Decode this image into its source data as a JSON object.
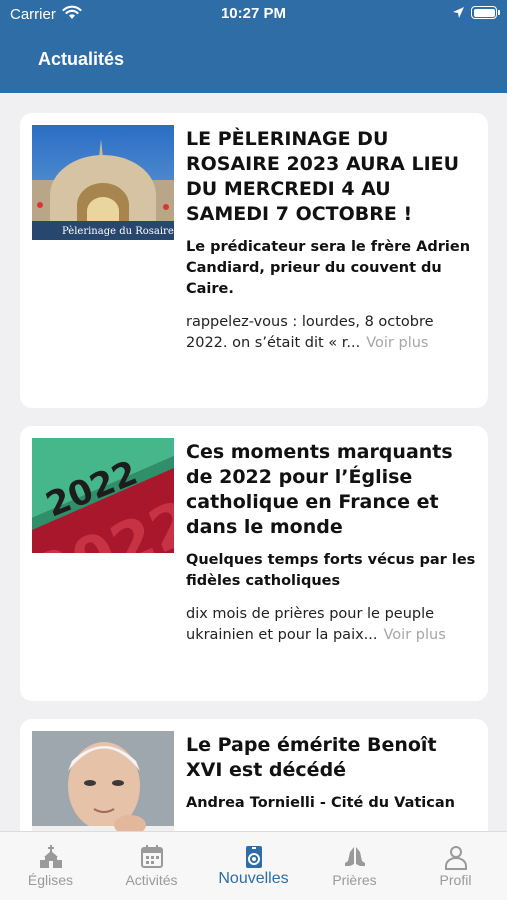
{
  "status": {
    "carrier": "Carrier",
    "time": "10:27 PM"
  },
  "header": {
    "title": "Actualités"
  },
  "articles": [
    {
      "title": "LE PÈLERINAGE DU ROSAIRE 2023 AURA LIEU DU MERCREDI 4 AU SAMEDI 7 OCTOBRE !",
      "subtitle": "Le prédicateur sera le frère Adrien Candiard, prieur du couvent du Caire.",
      "excerpt": "rappelez-vous : lourdes, 8 octobre 2022.  on s’était dit « r...",
      "more": "Voir plus",
      "image_caption": "Pèlerinage du Rosaire"
    },
    {
      "title": "Ces moments marquants de 2022 pour l’Église catholique en France et dans le monde",
      "subtitle": "Quelques temps forts vécus par les fidèles catholiques",
      "excerpt": "dix mois de prières pour le peuple ukrainien et pour la paix...",
      "more": "Voir plus",
      "image_text": "2022"
    },
    {
      "title": "Le Pape émérite Benoît XVI est décédé",
      "subtitle": "Andrea Tornielli - Cité du Vatican"
    }
  ],
  "tabs": [
    {
      "label": "Églises",
      "icon": "church-icon"
    },
    {
      "label": "Activités",
      "icon": "calendar-icon"
    },
    {
      "label": "Nouvelles",
      "icon": "news-icon",
      "active": true
    },
    {
      "label": "Prières",
      "icon": "praying-hands-icon"
    },
    {
      "label": "Profil",
      "icon": "person-icon"
    }
  ],
  "colors": {
    "header": "#2f6da6",
    "active_tab": "#2f6da6",
    "inactive_tab": "#9a9a9a",
    "background": "#f0f0f2"
  }
}
